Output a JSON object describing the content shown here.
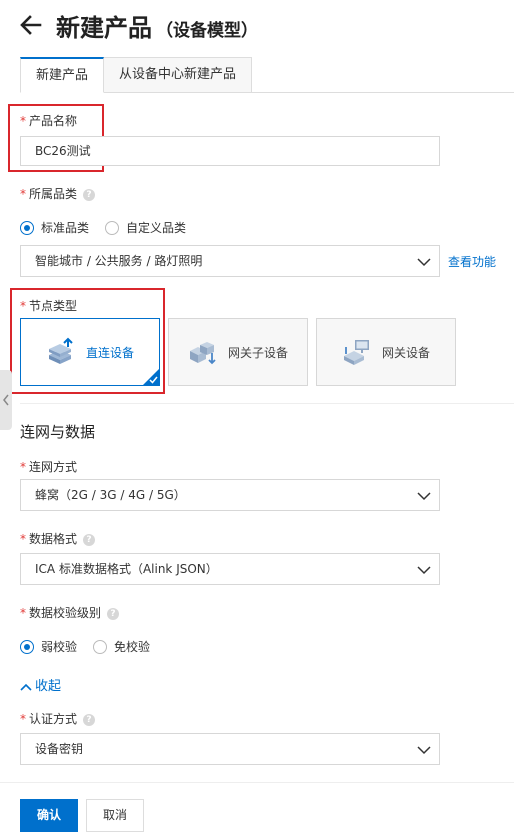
{
  "header": {
    "title": "新建产品",
    "subtitle": "（设备模型）"
  },
  "tabs": [
    {
      "label": "新建产品"
    },
    {
      "label": "从设备中心新建产品"
    }
  ],
  "form": {
    "product_name": {
      "label": "产品名称",
      "value": "BC26测试"
    },
    "category": {
      "label": "所属品类",
      "options": [
        "标准品类",
        "自定义品类"
      ],
      "selected": "智能城市 / 公共服务 / 路灯照明",
      "link": "查看功能"
    },
    "node_type": {
      "label": "节点类型",
      "cards": [
        "直连设备",
        "网关子设备",
        "网关设备"
      ]
    },
    "section_title": "连网与数据",
    "network": {
      "label": "连网方式",
      "value": "蜂窝（2G / 3G / 4G / 5G）"
    },
    "data_format": {
      "label": "数据格式",
      "value": "ICA 标准数据格式（Alink JSON）"
    },
    "verify_level": {
      "label": "数据校验级别",
      "options": [
        "弱校验",
        "免校验"
      ]
    },
    "collapse": "收起",
    "auth": {
      "label": "认证方式",
      "value": "设备密钥"
    }
  },
  "footer": {
    "confirm": "确认",
    "cancel": "取消"
  },
  "colors": {
    "accent": "#0070cc",
    "required": "#e23c39",
    "highlight_box": "#d9262c"
  }
}
